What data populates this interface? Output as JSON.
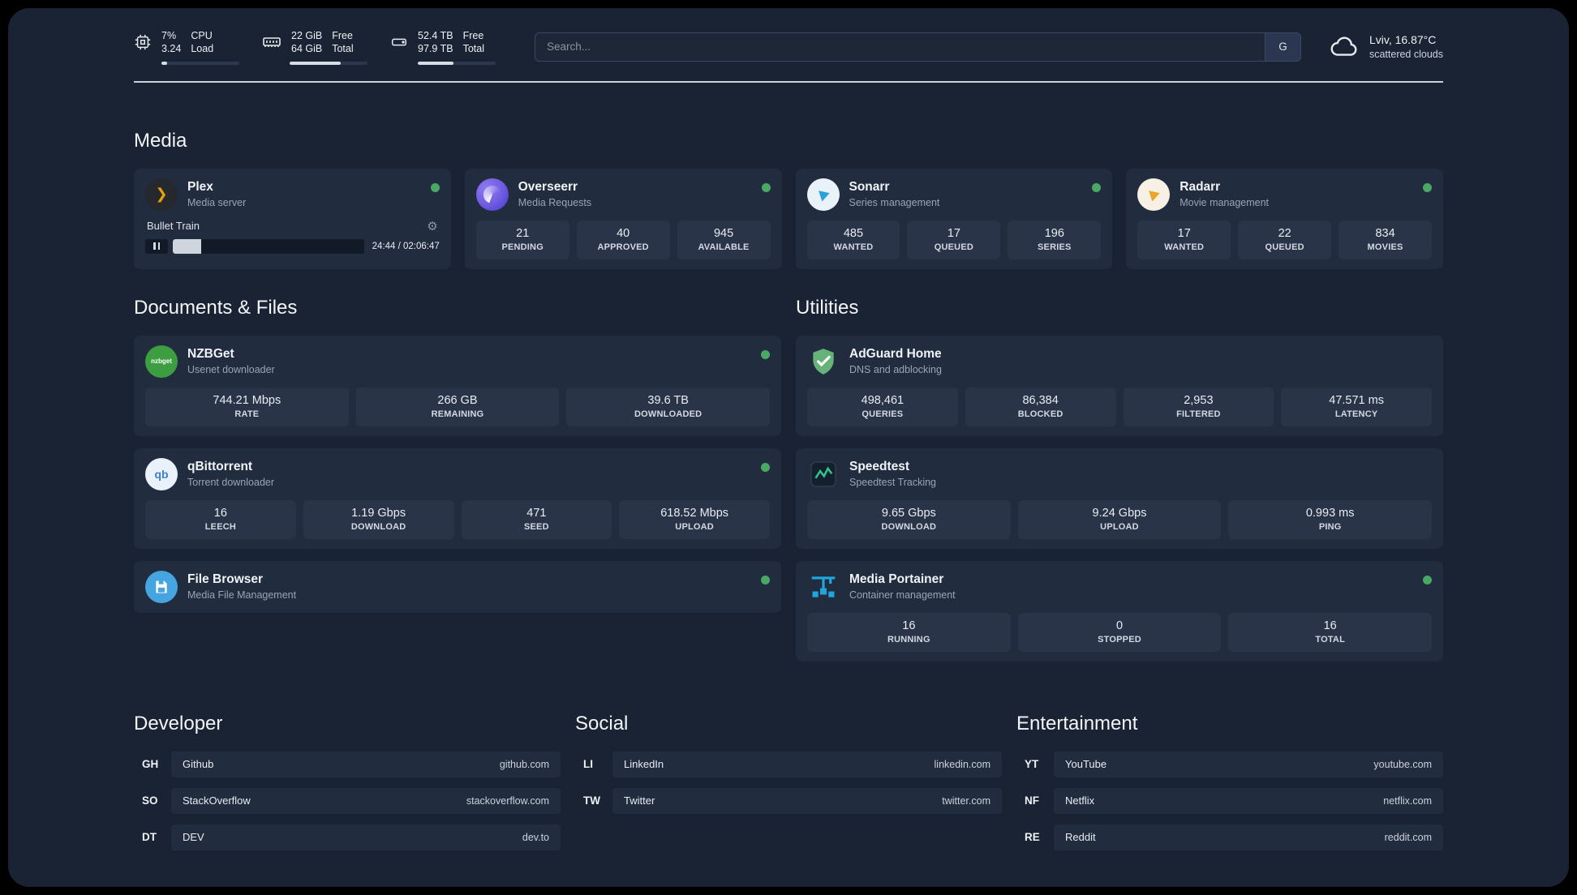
{
  "colors": {
    "status_green": "#4aa865",
    "plex_amber": "#e5a00d",
    "portainer_blue": "#1ea7df",
    "adguard_green": "#67b279",
    "speedtest_green": "#31c48d"
  },
  "topbar": {
    "cpu": {
      "line1": "7%",
      "line2": "3.24",
      "label1": "CPU",
      "label2": "Load",
      "progress": 7
    },
    "ram": {
      "line1": "22 GiB",
      "line2": "64 GiB",
      "label1": "Free",
      "label2": "Total",
      "progress": 66
    },
    "disk": {
      "line1": "52.4 TB",
      "line2": "97.9 TB",
      "label1": "Free",
      "label2": "Total",
      "progress": 46
    },
    "search": {
      "placeholder": "Search...",
      "button_label": "G"
    },
    "weather": {
      "location": "Lviv, 16.87°C",
      "condition": "scattered clouds"
    }
  },
  "media": {
    "title": "Media",
    "plex": {
      "name": "Plex",
      "subtitle": "Media server",
      "icon_glyph": "❯",
      "now_playing": "Bullet Train",
      "elapsed_total": "24:44 / 02:06:47",
      "progress": 15
    },
    "overseerr": {
      "name": "Overseerr",
      "subtitle": "Media Requests",
      "stats": [
        {
          "value": "21",
          "label": "PENDING"
        },
        {
          "value": "40",
          "label": "APPROVED"
        },
        {
          "value": "945",
          "label": "AVAILABLE"
        }
      ]
    },
    "sonarr": {
      "name": "Sonarr",
      "subtitle": "Series management",
      "stats": [
        {
          "value": "485",
          "label": "WANTED"
        },
        {
          "value": "17",
          "label": "QUEUED"
        },
        {
          "value": "196",
          "label": "SERIES"
        }
      ]
    },
    "radarr": {
      "name": "Radarr",
      "subtitle": "Movie management",
      "stats": [
        {
          "value": "17",
          "label": "WANTED"
        },
        {
          "value": "22",
          "label": "QUEUED"
        },
        {
          "value": "834",
          "label": "MOVIES"
        }
      ]
    }
  },
  "documents": {
    "title": "Documents & Files",
    "nzbget": {
      "name": "NZBGet",
      "subtitle": "Usenet downloader",
      "icon_text": "nzbget",
      "stats": [
        {
          "value": "744.21 Mbps",
          "label": "RATE"
        },
        {
          "value": "266 GB",
          "label": "REMAINING"
        },
        {
          "value": "39.6 TB",
          "label": "DOWNLOADED"
        }
      ]
    },
    "qbittorrent": {
      "name": "qBittorrent",
      "subtitle": "Torrent downloader",
      "icon_text": "qb",
      "stats": [
        {
          "value": "16",
          "label": "LEECH"
        },
        {
          "value": "1.19 Gbps",
          "label": "DOWNLOAD"
        },
        {
          "value": "471",
          "label": "SEED"
        },
        {
          "value": "618.52 Mbps",
          "label": "UPLOAD"
        }
      ]
    },
    "filebrowser": {
      "name": "File Browser",
      "subtitle": "Media File Management"
    }
  },
  "utilities": {
    "title": "Utilities",
    "adguard": {
      "name": "AdGuard Home",
      "subtitle": "DNS and adblocking",
      "stats": [
        {
          "value": "498,461",
          "label": "QUERIES"
        },
        {
          "value": "86,384",
          "label": "BLOCKED"
        },
        {
          "value": "2,953",
          "label": "FILTERED"
        },
        {
          "value": "47.571 ms",
          "label": "LATENCY"
        }
      ]
    },
    "speedtest": {
      "name": "Speedtest",
      "subtitle": "Speedtest Tracking",
      "stats": [
        {
          "value": "9.65 Gbps",
          "label": "DOWNLOAD"
        },
        {
          "value": "9.24 Gbps",
          "label": "UPLOAD"
        },
        {
          "value": "0.993 ms",
          "label": "PING"
        }
      ]
    },
    "portainer": {
      "name": "Media Portainer",
      "subtitle": "Container management",
      "stats": [
        {
          "value": "16",
          "label": "RUNNING"
        },
        {
          "value": "0",
          "label": "STOPPED"
        },
        {
          "value": "16",
          "label": "TOTAL"
        }
      ]
    }
  },
  "bookmarks": {
    "developer": {
      "title": "Developer",
      "items": [
        {
          "abbr": "GH",
          "name": "Github",
          "url": "github.com"
        },
        {
          "abbr": "SO",
          "name": "StackOverflow",
          "url": "stackoverflow.com"
        },
        {
          "abbr": "DT",
          "name": "DEV",
          "url": "dev.to"
        }
      ]
    },
    "social": {
      "title": "Social",
      "items": [
        {
          "abbr": "LI",
          "name": "LinkedIn",
          "url": "linkedin.com"
        },
        {
          "abbr": "TW",
          "name": "Twitter",
          "url": "twitter.com"
        }
      ]
    },
    "entertainment": {
      "title": "Entertainment",
      "items": [
        {
          "abbr": "YT",
          "name": "YouTube",
          "url": "youtube.com"
        },
        {
          "abbr": "NF",
          "name": "Netflix",
          "url": "netflix.com"
        },
        {
          "abbr": "RE",
          "name": "Reddit",
          "url": "reddit.com"
        }
      ]
    }
  }
}
